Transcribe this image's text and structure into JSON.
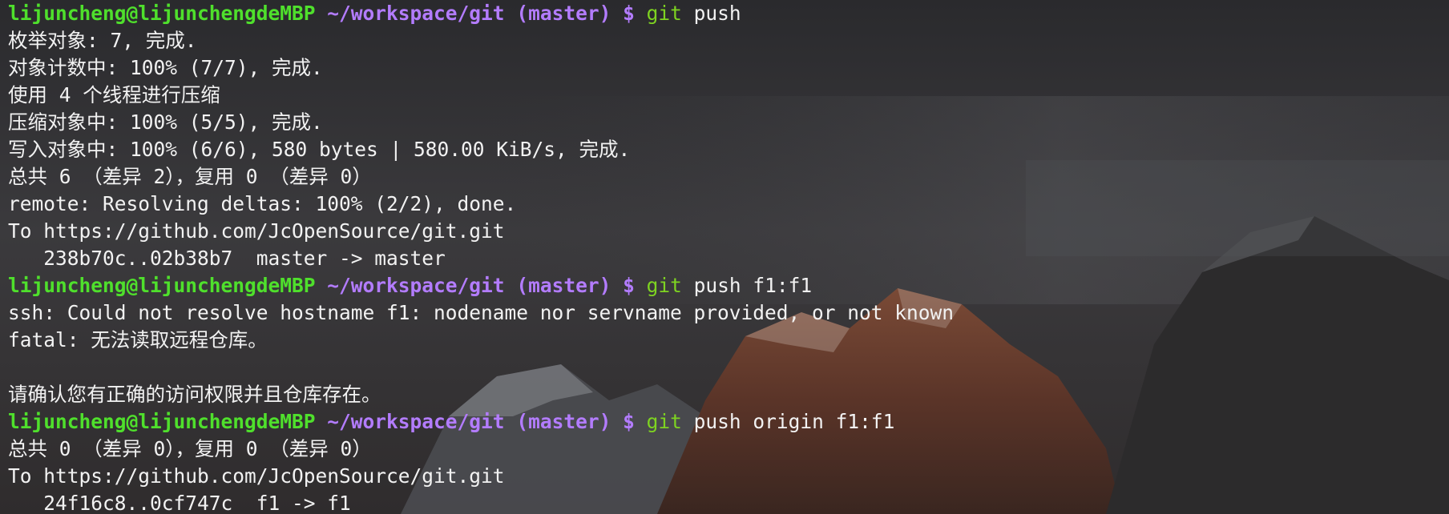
{
  "colors": {
    "prompt_user": "#4fe02c",
    "prompt_path": "#b37cff",
    "git_command": "#7ed321",
    "output_text": "#f2f2f2",
    "background": "#2b2b2e"
  },
  "terminal": {
    "lines": [
      {
        "type": "prompt",
        "user": "lijuncheng@lijunchengdeMBP",
        "path": "~/workspace/git",
        "branch": "(master)",
        "dollar": "$",
        "cmd": "git",
        "args": "push"
      },
      {
        "type": "output",
        "text": "枚举对象: 7, 完成."
      },
      {
        "type": "output",
        "text": "对象计数中: 100% (7/7), 完成."
      },
      {
        "type": "output",
        "text": "使用 4 个线程进行压缩"
      },
      {
        "type": "output",
        "text": "压缩对象中: 100% (5/5), 完成."
      },
      {
        "type": "output",
        "text": "写入对象中: 100% (6/6), 580 bytes | 580.00 KiB/s, 完成."
      },
      {
        "type": "output",
        "text": "总共 6 （差异 2），复用 0 （差异 0）"
      },
      {
        "type": "output",
        "text": "remote: Resolving deltas: 100% (2/2), done."
      },
      {
        "type": "output",
        "text": "To https://github.com/JcOpenSource/git.git"
      },
      {
        "type": "output",
        "text": "   238b70c..02b38b7  master -> master"
      },
      {
        "type": "prompt",
        "user": "lijuncheng@lijunchengdeMBP",
        "path": "~/workspace/git",
        "branch": "(master)",
        "dollar": "$",
        "cmd": "git",
        "args": "push f1:f1"
      },
      {
        "type": "output",
        "text": "ssh: Could not resolve hostname f1: nodename nor servname provided, or not known"
      },
      {
        "type": "output",
        "text": "fatal: 无法读取远程仓库。"
      },
      {
        "type": "output",
        "text": ""
      },
      {
        "type": "output",
        "text": "请确认您有正确的访问权限并且仓库存在。"
      },
      {
        "type": "prompt",
        "user": "lijuncheng@lijunchengdeMBP",
        "path": "~/workspace/git",
        "branch": "(master)",
        "dollar": "$",
        "cmd": "git",
        "args": "push origin f1:f1"
      },
      {
        "type": "output",
        "text": "总共 0 （差异 0），复用 0 （差异 0）"
      },
      {
        "type": "output",
        "text": "To https://github.com/JcOpenSource/git.git"
      },
      {
        "type": "output",
        "text": "   24f16c8..0cf747c  f1 -> f1"
      }
    ]
  }
}
